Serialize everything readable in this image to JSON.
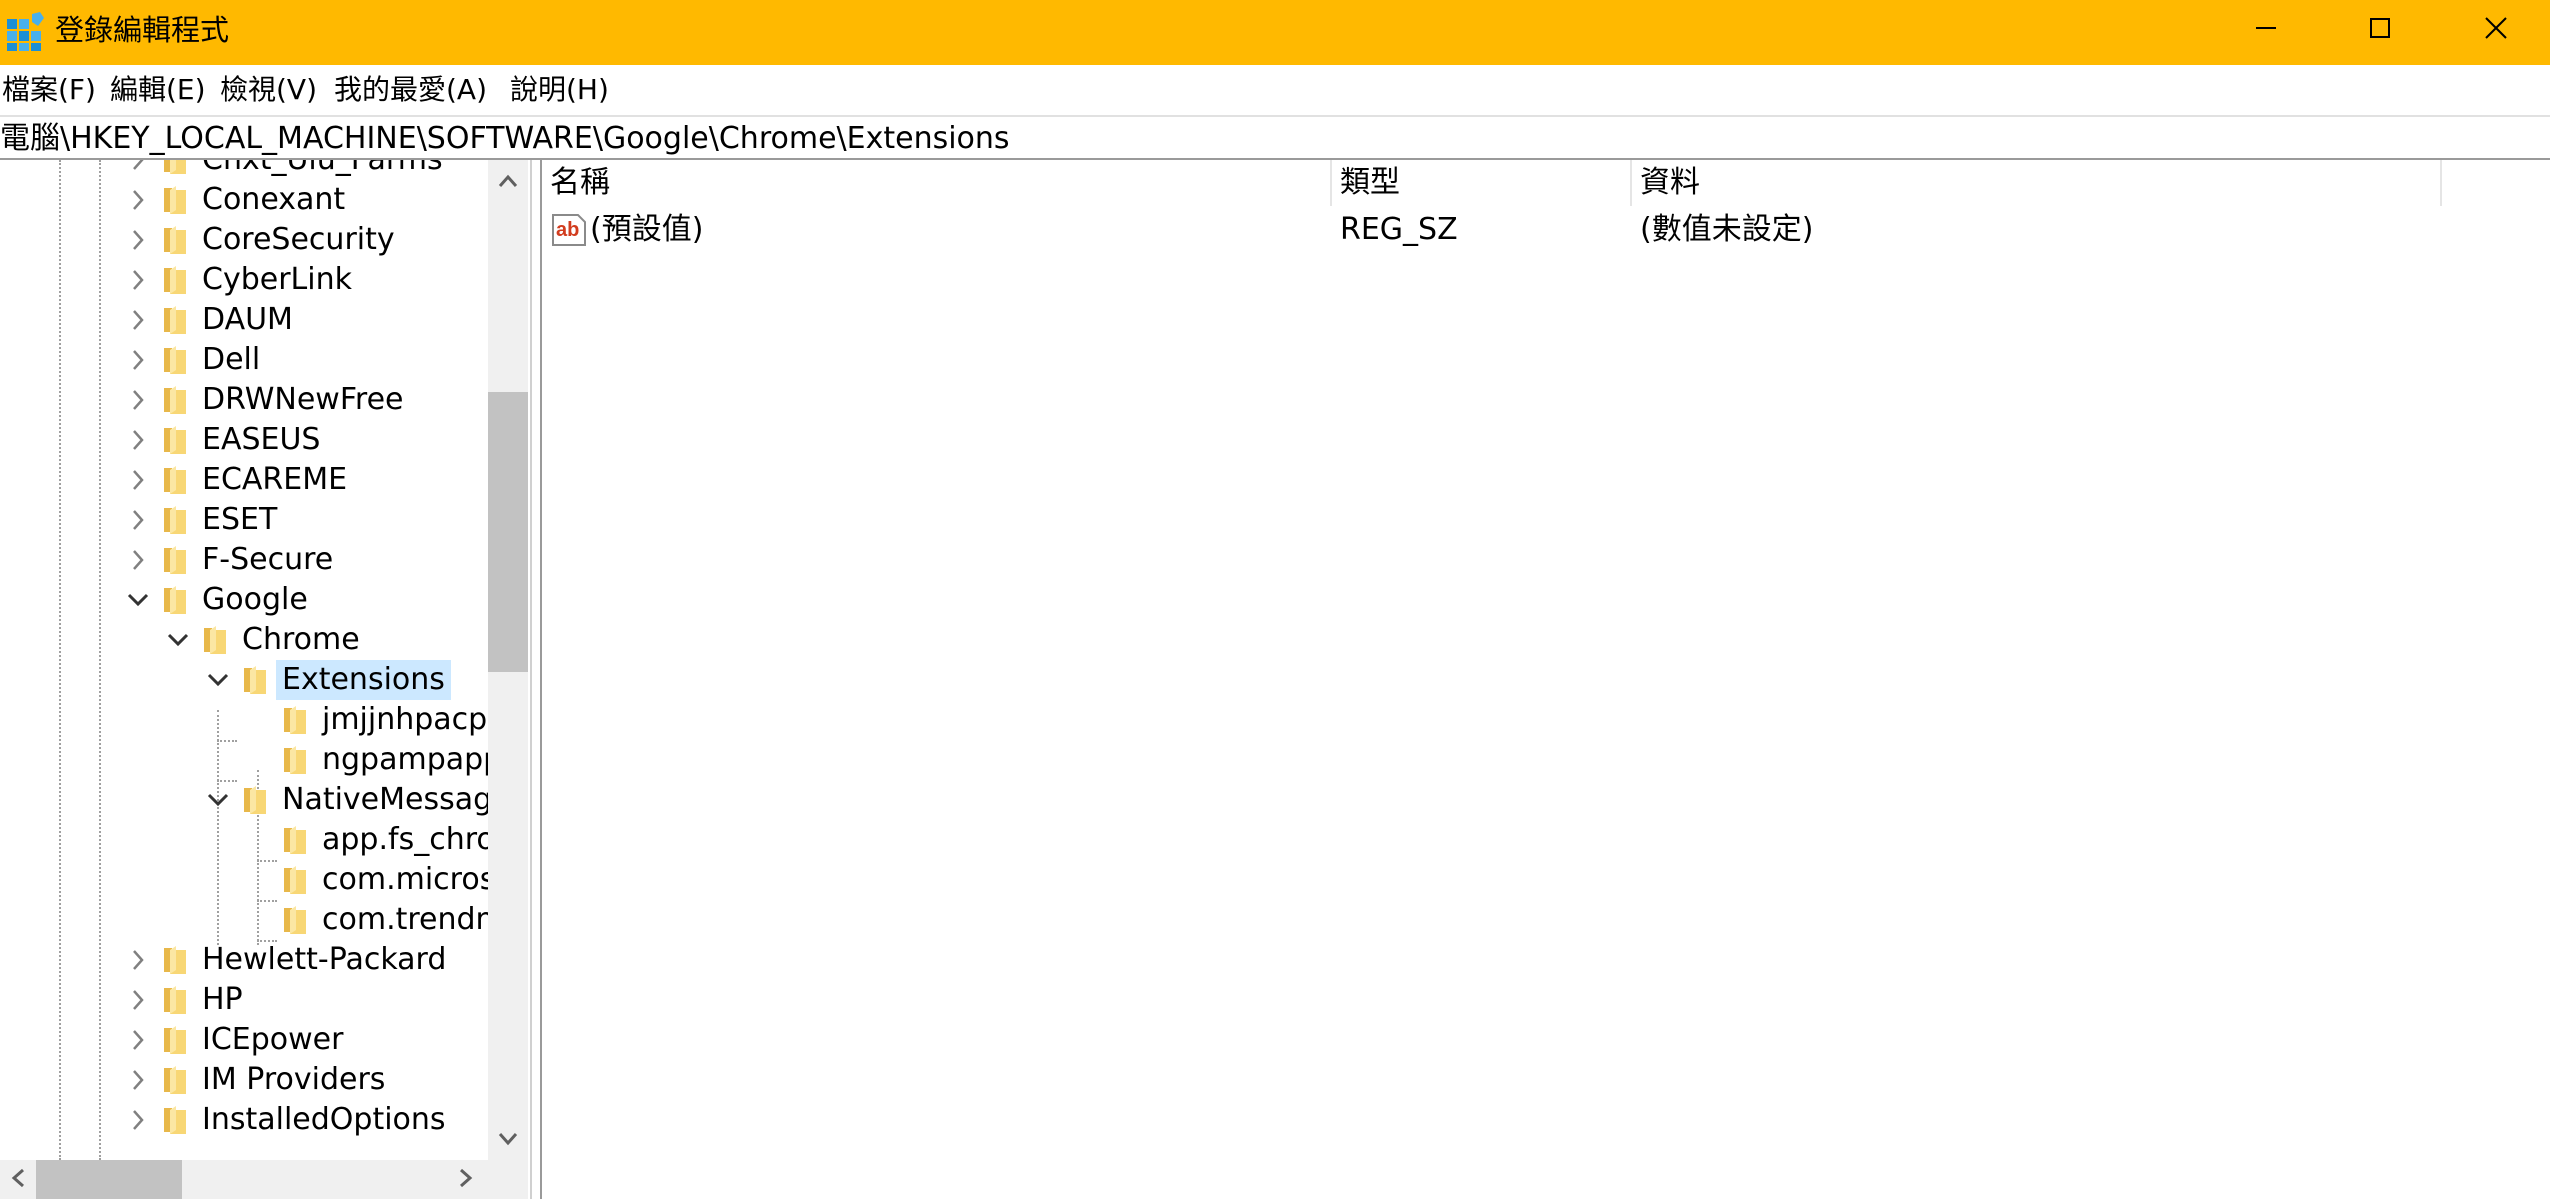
{
  "window": {
    "title": "登錄編輯程式",
    "icons": {
      "app": "registry-editor-icon",
      "minimize": "minimize-icon",
      "maximize": "maximize-icon",
      "close": "close-icon"
    }
  },
  "menu": {
    "items": [
      "檔案(F)",
      "編輯(E)",
      "檢視(V)",
      "我的最愛(A)",
      "說明(H)"
    ]
  },
  "address": {
    "path": "電腦\\HKEY_LOCAL_MACHINE\\SOFTWARE\\Google\\Chrome\\Extensions"
  },
  "tree": {
    "items": [
      {
        "label": "Cnxt_Uiu_Parms",
        "expander": "collapsed"
      },
      {
        "label": "Conexant",
        "expander": "collapsed"
      },
      {
        "label": "CoreSecurity",
        "expander": "collapsed"
      },
      {
        "label": "CyberLink",
        "expander": "collapsed"
      },
      {
        "label": "DAUM",
        "expander": "collapsed"
      },
      {
        "label": "Dell",
        "expander": "collapsed"
      },
      {
        "label": "DRWNewFree",
        "expander": "collapsed"
      },
      {
        "label": "EASEUS",
        "expander": "collapsed"
      },
      {
        "label": "ECAREME",
        "expander": "collapsed"
      },
      {
        "label": "ESET",
        "expander": "collapsed"
      },
      {
        "label": "F-Secure",
        "expander": "collapsed"
      },
      {
        "label": "Google",
        "expander": "expanded"
      },
      {
        "label": "Chrome",
        "expander": "expanded"
      },
      {
        "label": "Extensions",
        "expander": "expanded",
        "selected": true
      },
      {
        "label": "jmjjnhpacph",
        "expander": "none"
      },
      {
        "label": "ngpampapp",
        "expander": "none"
      },
      {
        "label": "NativeMessagi",
        "expander": "expanded"
      },
      {
        "label": "app.fs_chron",
        "expander": "none"
      },
      {
        "label": "com.micros",
        "expander": "none"
      },
      {
        "label": "com.trendm",
        "expander": "none"
      },
      {
        "label": "Hewlett-Packard",
        "expander": "collapsed"
      },
      {
        "label": "HP",
        "expander": "collapsed"
      },
      {
        "label": "ICEpower",
        "expander": "collapsed"
      },
      {
        "label": "IM Providers",
        "expander": "collapsed"
      },
      {
        "label": "InstalledOptions",
        "expander": "collapsed"
      }
    ]
  },
  "list": {
    "columns": [
      "名稱",
      "類型",
      "資料"
    ],
    "rows": [
      {
        "name": "(預設值)",
        "type": "REG_SZ",
        "data": "(數值未設定)",
        "icon": "reg-sz-ab-icon"
      }
    ]
  },
  "colors": {
    "titlebar": "#ffb900",
    "selection": "#cce8ff",
    "folder": "#f8d775"
  }
}
